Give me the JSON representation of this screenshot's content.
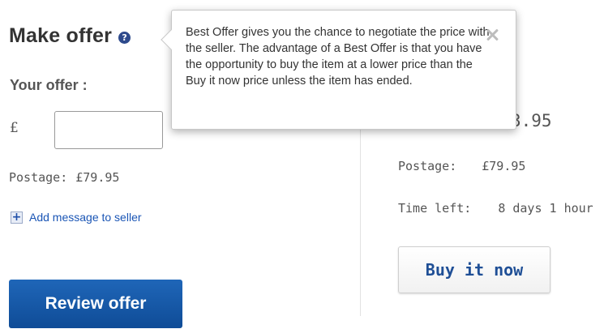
{
  "make_offer": {
    "title": "Make offer",
    "help_icon_glyph": "?",
    "your_offer_label": "Your offer :",
    "currency_symbol": "£",
    "offer_input_value": "",
    "postage_label": "Postage:",
    "postage_value": "£79.95",
    "add_message_label": "Add message to seller",
    "review_button_label": "Review offer"
  },
  "buy_now": {
    "price_fragment": "3.95",
    "postage_label": "Postage:",
    "postage_value": "£79.95",
    "time_left_label": "Time left:",
    "time_left_value": "8 days 1 hour",
    "buy_button_label": "Buy it now"
  },
  "tooltip": {
    "text": "Best Offer gives you the chance to negotiate the price with the seller. The advantage of a Best Offer is that you have the opportunity to buy the item at a lower price than the Buy it now price unless the item has ended."
  },
  "icons": {
    "help": "question-circle-icon",
    "add": "plus-square-icon",
    "close": "close-icon"
  },
  "colors": {
    "primary_button": "#0f4c97",
    "link": "#1a55b5",
    "help_icon": "#2e4a8c"
  }
}
